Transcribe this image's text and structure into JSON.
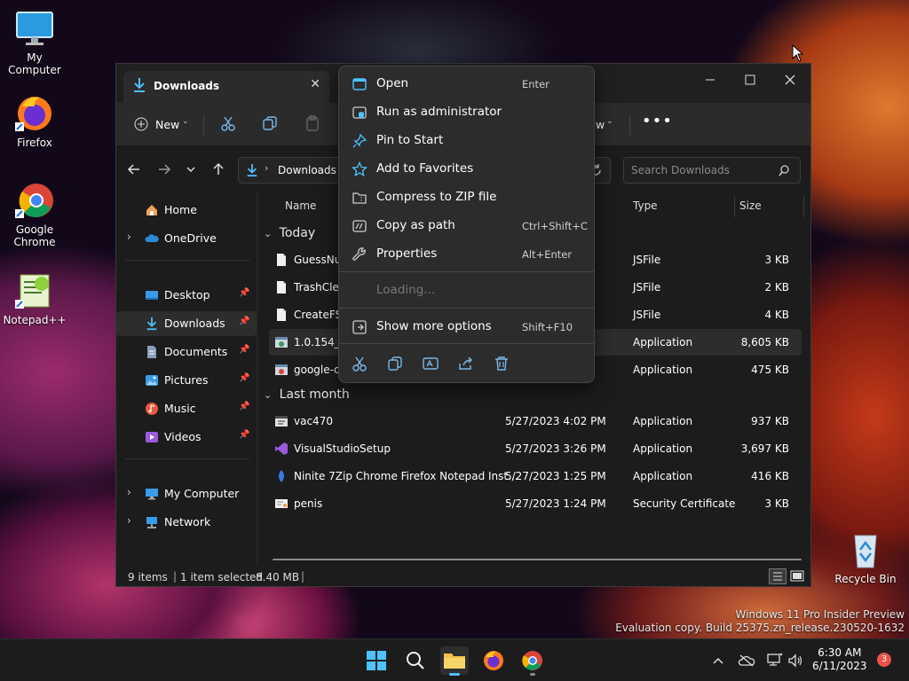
{
  "desktop": {
    "icons": [
      {
        "label": "My Computer"
      },
      {
        "label": "Firefox"
      },
      {
        "label": "Google Chrome"
      },
      {
        "label": "Notepad++"
      },
      {
        "label": "Recycle Bin"
      }
    ],
    "watermark": {
      "line1": "Windows 11 Pro Insider Preview",
      "line2": "Evaluation copy. Build 25375.zn_release.230520-1632"
    }
  },
  "explorer": {
    "tab": {
      "title": "Downloads"
    },
    "toolbar": {
      "new_label": "New",
      "view_label": "w"
    },
    "address": {
      "path": "Downloads"
    },
    "search": {
      "placeholder": "Search Downloads"
    },
    "nav": {
      "items": [
        {
          "label": "Home"
        },
        {
          "label": "OneDrive"
        },
        {
          "label": "Desktop"
        },
        {
          "label": "Downloads"
        },
        {
          "label": "Documents"
        },
        {
          "label": "Pictures"
        },
        {
          "label": "Music"
        },
        {
          "label": "Videos"
        },
        {
          "label": "My Computer"
        },
        {
          "label": "Network"
        }
      ]
    },
    "columns": {
      "name": "Name",
      "type": "Type",
      "size": "Size"
    },
    "groups": {
      "today": "Today",
      "last_month": "Last month"
    },
    "files": [
      {
        "name": "GuessNur",
        "date": "",
        "type": "JSFile",
        "size": "3 KB"
      },
      {
        "name": "TrashClear",
        "date": "",
        "type": "JSFile",
        "size": "2 KB"
      },
      {
        "name": "CreateFS.j",
        "date": "",
        "type": "JSFile",
        "size": "4 KB"
      },
      {
        "name": "1.0.154_ch",
        "date": "",
        "type": "Application",
        "size": "8,605 KB"
      },
      {
        "name": "google-ch",
        "date": "",
        "type": "Application",
        "size": "475 KB"
      },
      {
        "name": "vac470",
        "date": "5/27/2023 4:02 PM",
        "type": "Application",
        "size": "937 KB"
      },
      {
        "name": "VisualStudioSetup",
        "date": "5/27/2023 3:26 PM",
        "type": "Application",
        "size": "3,697 KB"
      },
      {
        "name": "Ninite 7Zip Chrome Firefox Notepad Inst...",
        "date": "5/27/2023 1:25 PM",
        "type": "Application",
        "size": "416 KB"
      },
      {
        "name": "penis",
        "date": "5/27/2023 1:24 PM",
        "type": "Security Certificate",
        "size": "3 KB"
      }
    ],
    "status": {
      "items": "9 items",
      "selected": "1 item selected",
      "size": "8.40 MB"
    }
  },
  "context_menu": {
    "items": [
      {
        "label": "Open",
        "shortcut": "Enter",
        "icon": "open-icon"
      },
      {
        "label": "Run as administrator",
        "shortcut": "",
        "icon": "shield-icon"
      },
      {
        "label": "Pin to Start",
        "shortcut": "",
        "icon": "pin-icon"
      },
      {
        "label": "Add to Favorites",
        "shortcut": "",
        "icon": "star-icon"
      },
      {
        "label": "Compress to ZIP file",
        "shortcut": "",
        "icon": "zip-icon"
      },
      {
        "label": "Copy as path",
        "shortcut": "Ctrl+Shift+C",
        "icon": "path-icon"
      },
      {
        "label": "Properties",
        "shortcut": "Alt+Enter",
        "icon": "wrench-icon"
      }
    ],
    "loading": "Loading...",
    "more": {
      "label": "Show more options",
      "shortcut": "Shift+F10"
    }
  },
  "taskbar": {
    "time": "6:30 AM",
    "date": "6/11/2023",
    "notifications": "3"
  },
  "colors": {
    "accent": "#4cc2ff",
    "folder": "#f3c24a",
    "badge": "#e8534a"
  }
}
